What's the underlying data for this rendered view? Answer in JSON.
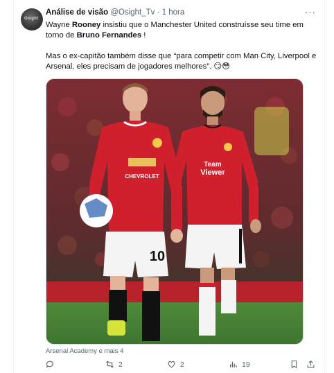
{
  "tweet": {
    "author_name": "Análise de visão",
    "handle": "@Osight_Tv",
    "separator": "·",
    "time": "1 hora",
    "avatar_text": "Osight",
    "more_label": "···",
    "text_line1_a": "Wayne ",
    "text_line1_b": "Rooney",
    "text_line1_c": " insistiu que o Manchester United construísse seu time em torno de ",
    "text_line1_d": "Bruno Fernandes",
    "text_line1_e": " !",
    "text_para2": "Mas o ex-capitão também disse que “para competir com Man City, Liverpool e Arsenal, eles precisam de jogadores melhores”. 😏😳",
    "media_caption": "Arsenal Academy e mais 4",
    "media": {
      "left_sponsor": "CHEVROLET",
      "left_number": "10",
      "right_sponsor": "Team",
      "right_sponsor_2": "Viewer"
    },
    "actions": {
      "reply_count": "",
      "retweet_count": "2",
      "like_count": "2",
      "views_count": "19"
    }
  },
  "colors": {
    "text_primary": "#0f1419",
    "text_secondary": "#536471",
    "border": "#cfd9de",
    "united_red": "#d0202e"
  }
}
